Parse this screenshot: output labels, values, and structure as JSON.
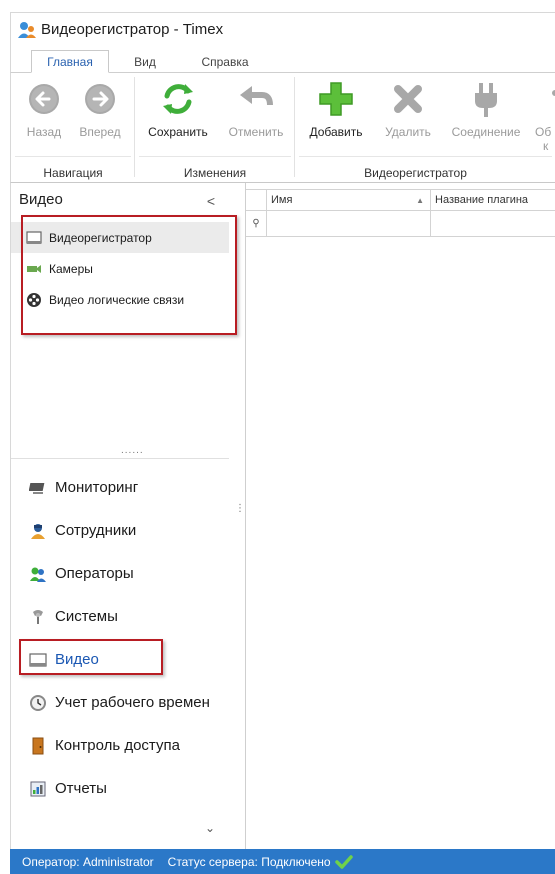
{
  "window": {
    "title": "Видеорегистратор - Timex"
  },
  "ribbon_tabs": [
    {
      "label": "Главная",
      "active": true
    },
    {
      "label": "Вид"
    },
    {
      "label": "Справка"
    }
  ],
  "ribbon": {
    "groups": {
      "navigation": "Навигация",
      "changes": "Изменения",
      "dvr": "Видеорегистратор"
    },
    "buttons": {
      "back": "Назад",
      "forward": "Вперед",
      "save": "Сохранить",
      "undo": "Отменить",
      "add": "Добавить",
      "delete": "Удалить",
      "connect": "Соединение",
      "cut_1": "Об",
      "cut_2": "к"
    }
  },
  "nav": {
    "header": "Видео",
    "collapse": "<",
    "sub_items": [
      {
        "label": "Видеорегистратор",
        "icon": "dvr-icon",
        "selected": true
      },
      {
        "label": "Камеры",
        "icon": "camera-icon"
      },
      {
        "label": "Видео логические связи",
        "icon": "film-reel-icon"
      }
    ],
    "splitter": "......",
    "vert_dots": "⋮",
    "main_items": [
      {
        "label": "Мониторинг",
        "icon": "monitor-icon"
      },
      {
        "label": "Сотрудники",
        "icon": "employees-icon"
      },
      {
        "label": "Операторы",
        "icon": "operators-icon"
      },
      {
        "label": "Системы",
        "icon": "systems-icon"
      },
      {
        "label": "Видео",
        "icon": "video-icon",
        "active": true
      },
      {
        "label": "Учет рабочего времен",
        "icon": "clock-icon"
      },
      {
        "label": "Контроль доступа",
        "icon": "door-icon"
      },
      {
        "label": "Отчеты",
        "icon": "reports-icon"
      }
    ],
    "more": "⌄"
  },
  "grid": {
    "columns": [
      "Имя",
      "Название плагина"
    ],
    "sort_indicator": "▲",
    "filter_icon": "⚲"
  },
  "status": {
    "operator": "Оператор: Administrator",
    "server": "Статус сервера: Подключено"
  },
  "colors": {
    "accent": "#2b78c8",
    "highlight_box": "#b81d23",
    "active_text": "#1a57b3"
  }
}
